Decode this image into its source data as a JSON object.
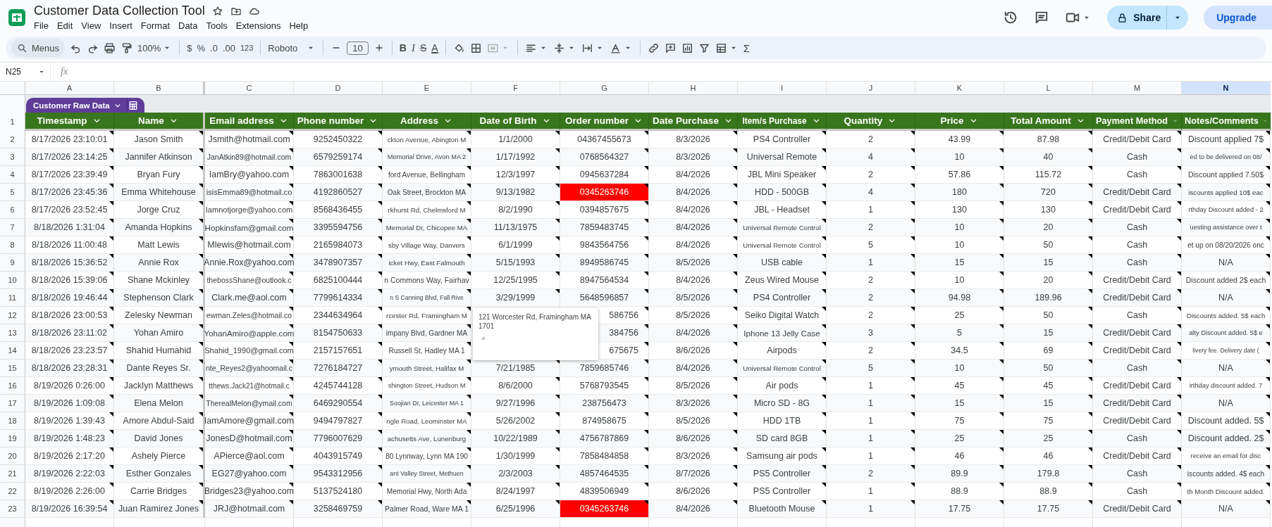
{
  "app": {
    "title": "Customer Data Collection Tool",
    "menus": [
      "File",
      "Edit",
      "View",
      "Insert",
      "Format",
      "Data",
      "Tools",
      "Extensions",
      "Help"
    ],
    "share": "Share",
    "upgrade": "Upgrade"
  },
  "toolbar": {
    "search_placeholder": "Menus",
    "zoom": "100%",
    "currency": "$",
    "percent": "%",
    "decrease_decimals": ".0",
    "increase_decimals": ".00",
    "number_format": "123",
    "font": "Roboto",
    "font_size": "10",
    "bold": "B",
    "italic": "I",
    "strikethrough": "S",
    "text_color": "A",
    "sum": "Σ"
  },
  "formula_bar": {
    "cell_ref": "N25",
    "function_label": "fx"
  },
  "column_letters": [
    {
      "letter": "A",
      "selected": false
    },
    {
      "letter": "B",
      "selected": false
    },
    {
      "letter": "C",
      "selected": false
    },
    {
      "letter": "D",
      "selected": false
    },
    {
      "letter": "E",
      "selected": false
    },
    {
      "letter": "F",
      "selected": false
    },
    {
      "letter": "G",
      "selected": false
    },
    {
      "letter": "H",
      "selected": false
    },
    {
      "letter": "I",
      "selected": false
    },
    {
      "letter": "J",
      "selected": false
    },
    {
      "letter": "K",
      "selected": false
    },
    {
      "letter": "L",
      "selected": false
    },
    {
      "letter": "M",
      "selected": false
    },
    {
      "letter": "N",
      "selected": true
    }
  ],
  "table": {
    "name": "Customer Raw Data",
    "header_row_number": "1",
    "columns": [
      "Timestamp",
      "Name",
      "Email address",
      "Phone number",
      "Address",
      "Date of Birth",
      "Order number",
      "Date Purchase",
      "Item/s Purchase",
      "Quantity",
      "Price",
      "Total Amount",
      "Payment Method",
      "Notes/Comments"
    ],
    "rows": [
      {
        "number": "2",
        "order_flagged": false,
        "cells": [
          "8/17/2026 23:10:01",
          "Jason Smith",
          "Jsmith@hotmail.com",
          "9252450322",
          "ckton Avenue, Abington M",
          "1/1/2000",
          "04367455673",
          "8/3/2026",
          "PS4 Controller",
          "2",
          "43.99",
          "87.98",
          "Credit/Debit Card",
          "Discount applied 7$"
        ]
      },
      {
        "number": "3",
        "order_flagged": false,
        "cells": [
          "8/17/2026 23:14:25",
          "Jannifer Atkinson",
          "JanAtkin89@hotmail.com",
          "6579259174",
          "Memorial Drive, Avon MA 2",
          "1/17/1992",
          "0768564327",
          "8/3/2026",
          "Universal Remote",
          "4",
          "10",
          "40",
          "Cash",
          "ed to be delivered on 08/"
        ]
      },
      {
        "number": "4",
        "order_flagged": false,
        "cells": [
          "8/17/2026 23:39:49",
          "Bryan Fury",
          "IamBry@yahoo.com",
          "7863001638",
          "ford Avenue, Bellingham",
          "12/3/1997",
          "0945637284",
          "8/4/2026",
          "JBL Mini Speaker",
          "2",
          "57.86",
          "115.72",
          "Cash",
          "Discount applied 7.50$"
        ]
      },
      {
        "number": "5",
        "order_flagged": true,
        "cells": [
          "8/17/2026 23:45:36",
          "Emma Whitehouse",
          "isisEmma89@hotmail.co",
          "4192860527",
          "Oak Street, Brockton MA",
          "9/13/1982",
          "0345263746",
          "8/4/2026",
          "HDD - 500GB",
          "4",
          "180",
          "720",
          "Credit/Debit Card",
          "iscounts applied 10$ eac"
        ]
      },
      {
        "number": "6",
        "order_flagged": false,
        "cells": [
          "8/17/2026 23:52:45",
          "Jorge Cruz",
          "Iamnotjorge@yahoo.com",
          "8568436455",
          "rkhurst Rd, Chelmsford M",
          "8/2/1990",
          "0394857675",
          "8/4/2026",
          "JBL - Headset",
          "1",
          "130",
          "130",
          "Credit/Debit Card",
          "rthday Discount added - 2"
        ]
      },
      {
        "number": "7",
        "order_flagged": false,
        "cells": [
          "8/18/2026 1:31:04",
          "Amanda Hopkins",
          "Hopkinsfam@gmail.com",
          "3395594756",
          "Memorial Dr, Chicopee MA",
          "11/13/1975",
          "7859483745",
          "8/4/2026",
          "Universal Remote Control",
          "2",
          "10",
          "20",
          "Cash",
          "uesting assistance over t"
        ]
      },
      {
        "number": "8",
        "order_flagged": false,
        "cells": [
          "8/18/2026 11:00:48",
          "Matt Lewis",
          "Mlewis@hotmail.com",
          "2165984073",
          "sby Village Way, Danvers",
          "6/1/1999",
          "9843564756",
          "8/4/2026",
          "Universal Remote Control",
          "5",
          "10",
          "50",
          "Cash",
          "et up on 08/20/2026 onc"
        ]
      },
      {
        "number": "9",
        "order_flagged": false,
        "cells": [
          "8/18/2026 15:36:52",
          "Annie Rox",
          "Annie.Rox@yahoo.com",
          "3478907357",
          "icket Hwy, East Falmouth",
          "5/15/1993",
          "8949586745",
          "8/5/2026",
          "USB cable",
          "1",
          "15",
          "15",
          "Cash",
          "N/A"
        ]
      },
      {
        "number": "10",
        "order_flagged": false,
        "cells": [
          "8/18/2026 15:39:06",
          "Shane Mckinley",
          "thebossShane@outlook.c",
          "6825100444",
          "n Commons Way, Fairhav",
          "12/25/1995",
          "8947564534",
          "8/4/2026",
          "Zeus Wired Mouse",
          "2",
          "10",
          "20",
          "Credit/Debit Card",
          "Discount added 2$ each"
        ]
      },
      {
        "number": "11",
        "order_flagged": false,
        "cells": [
          "8/18/2026 19:46:44",
          "Stephenson Clark",
          "Clark.me@aol.com",
          "7799614334",
          "n S Canning Blvd, Fall Rive",
          "3/29/1999",
          "5648596857",
          "8/5/2026",
          "PS4 Controller",
          "2",
          "94.98",
          "189.96",
          "Credit/Debit Card",
          "N/A"
        ]
      },
      {
        "number": "12",
        "order_flagged": false,
        "cells": [
          "8/18/2026 23:00:53",
          "Zelesky Newman",
          "ewman.Zeles@hotmail.co",
          "2344634964",
          "rcester Rd, Framingham M",
          null,
          "586756",
          "8/5/2026",
          "Seiko Digital Watch",
          "2",
          "25",
          "50",
          "Cash",
          "Discounts added. 5$ each"
        ]
      },
      {
        "number": "13",
        "order_flagged": false,
        "cells": [
          "8/18/2026 23:11:02",
          "Yohan Amiro",
          "YohanAmiro@apple.com",
          "8154750633",
          "impany Blvd, Gardner MA",
          null,
          "384756",
          "8/4/2026",
          "Iphone 13 Jelly Case",
          "3",
          "5",
          "15",
          "Credit/Debit Card",
          "alty Discount added. 5$ e"
        ]
      },
      {
        "number": "14",
        "order_flagged": false,
        "cells": [
          "8/18/2026 23:23:57",
          "Shahid Humahid",
          "Shahid_1990@gmail.com",
          "2157157651",
          "Russell St, Hadley MA 1",
          null,
          "675675",
          "8/6/2026",
          "Airpods",
          "2",
          "34.5",
          "69",
          "Credit/Debit Card",
          "livery fee. Delivery date ("
        ]
      },
      {
        "number": "15",
        "order_flagged": false,
        "cells": [
          "8/18/2026 23:28:31",
          "Dante Reyes Sr.",
          "nte_Reyes2@yahoomail.c",
          "7276184727",
          "ymouth Street, Halifax M",
          "7/21/1985",
          "7859685746",
          "8/4/2026",
          "Universal Remote Control",
          "5",
          "10",
          "50",
          "Cash",
          "N/A"
        ]
      },
      {
        "number": "16",
        "order_flagged": false,
        "cells": [
          "8/19/2026 0:26:00",
          "Jacklyn Matthews",
          "tthews.Jack21@hotmail.c",
          "4245744128",
          "shington Street, Hudson M",
          "8/6/2000",
          "5768793545",
          "8/5/2026",
          "Air pods",
          "1",
          "45",
          "45",
          "Credit/Debit Card",
          "irthday discount added. 7"
        ]
      },
      {
        "number": "17",
        "order_flagged": false,
        "cells": [
          "8/19/2026 1:09:08",
          "Elena Melon",
          "TherealMelon@ymail.com",
          "6469290554",
          "Soojian Dr, Leicester MA 1",
          "9/27/1996",
          "238756473",
          "8/3/2026",
          "Micro SD - 8G",
          "1",
          "15",
          "15",
          "Credit/Debit Card",
          "N/A"
        ]
      },
      {
        "number": "18",
        "order_flagged": false,
        "cells": [
          "8/19/2026 1:39:43",
          "Amore Abdul-Said",
          "IamAmore@gmail.com",
          "9494797827",
          "ngle Road, Leominster MA",
          "5/26/2002",
          "874958675",
          "8/5/2026",
          "HDD 1TB",
          "1",
          "75",
          "75",
          "Credit/Debit Card",
          "Discount added. 5$"
        ]
      },
      {
        "number": "19",
        "order_flagged": false,
        "cells": [
          "8/19/2026 1:48:23",
          "David Jones",
          "JonesD@hotmail.com",
          "7796007629",
          "achusetts Ave, Lunenburg",
          "10/22/1989",
          "4756787869",
          "8/6/2026",
          "SD card 8GB",
          "1",
          "25",
          "25",
          "Cash",
          "Discount added. 2$"
        ]
      },
      {
        "number": "20",
        "order_flagged": false,
        "cells": [
          "8/19/2026 2:17:20",
          "Ashely Pierce",
          "APierce@aol.com",
          "4043915749",
          "80 Lynnway, Lynn MA 190",
          "1/30/1999",
          "7858484858",
          "8/3/2026",
          "Samsung air pods",
          "1",
          "46",
          "46",
          "Credit/Debit Card",
          "receive an email for disc"
        ]
      },
      {
        "number": "21",
        "order_flagged": false,
        "cells": [
          "8/19/2026 2:22:03",
          "Esther Gonzales",
          "EG27@yahoo.com",
          "9543312956",
          "ant Valley Street, Methuen",
          "2/3/2003",
          "4857464535",
          "8/7/2026",
          "PS5 Controller",
          "2",
          "89.9",
          "179.8",
          "Cash",
          "iscounts added. 4$ each"
        ]
      },
      {
        "number": "22",
        "order_flagged": false,
        "cells": [
          "8/19/2026 2:26:00",
          "Carrie Bridges",
          "Bridges23@yahoo.com",
          "5137524180",
          "Memorial Hwy, North Ada",
          "8/24/1997",
          "4839506949",
          "8/6/2026",
          "PS5 Controller",
          "1",
          "88.9",
          "88.9",
          "Cash",
          "th Month Discount added."
        ]
      },
      {
        "number": "23",
        "order_flagged": true,
        "cells": [
          "8/19/2026 16:39:54",
          "Juan Ramirez Jones",
          "JRJ@hotmail.com",
          "3258469759",
          "Palmer Road, Ware MA 1",
          "6/25/1996",
          "0345263746",
          "8/4/2026",
          "Bluetooth Mouse",
          "1",
          "17.75",
          "17.75",
          "Credit/Debit Card",
          "N/A"
        ]
      }
    ]
  },
  "cell_note": {
    "text": "121 Worcester Rd, Framingham MA 1701"
  }
}
